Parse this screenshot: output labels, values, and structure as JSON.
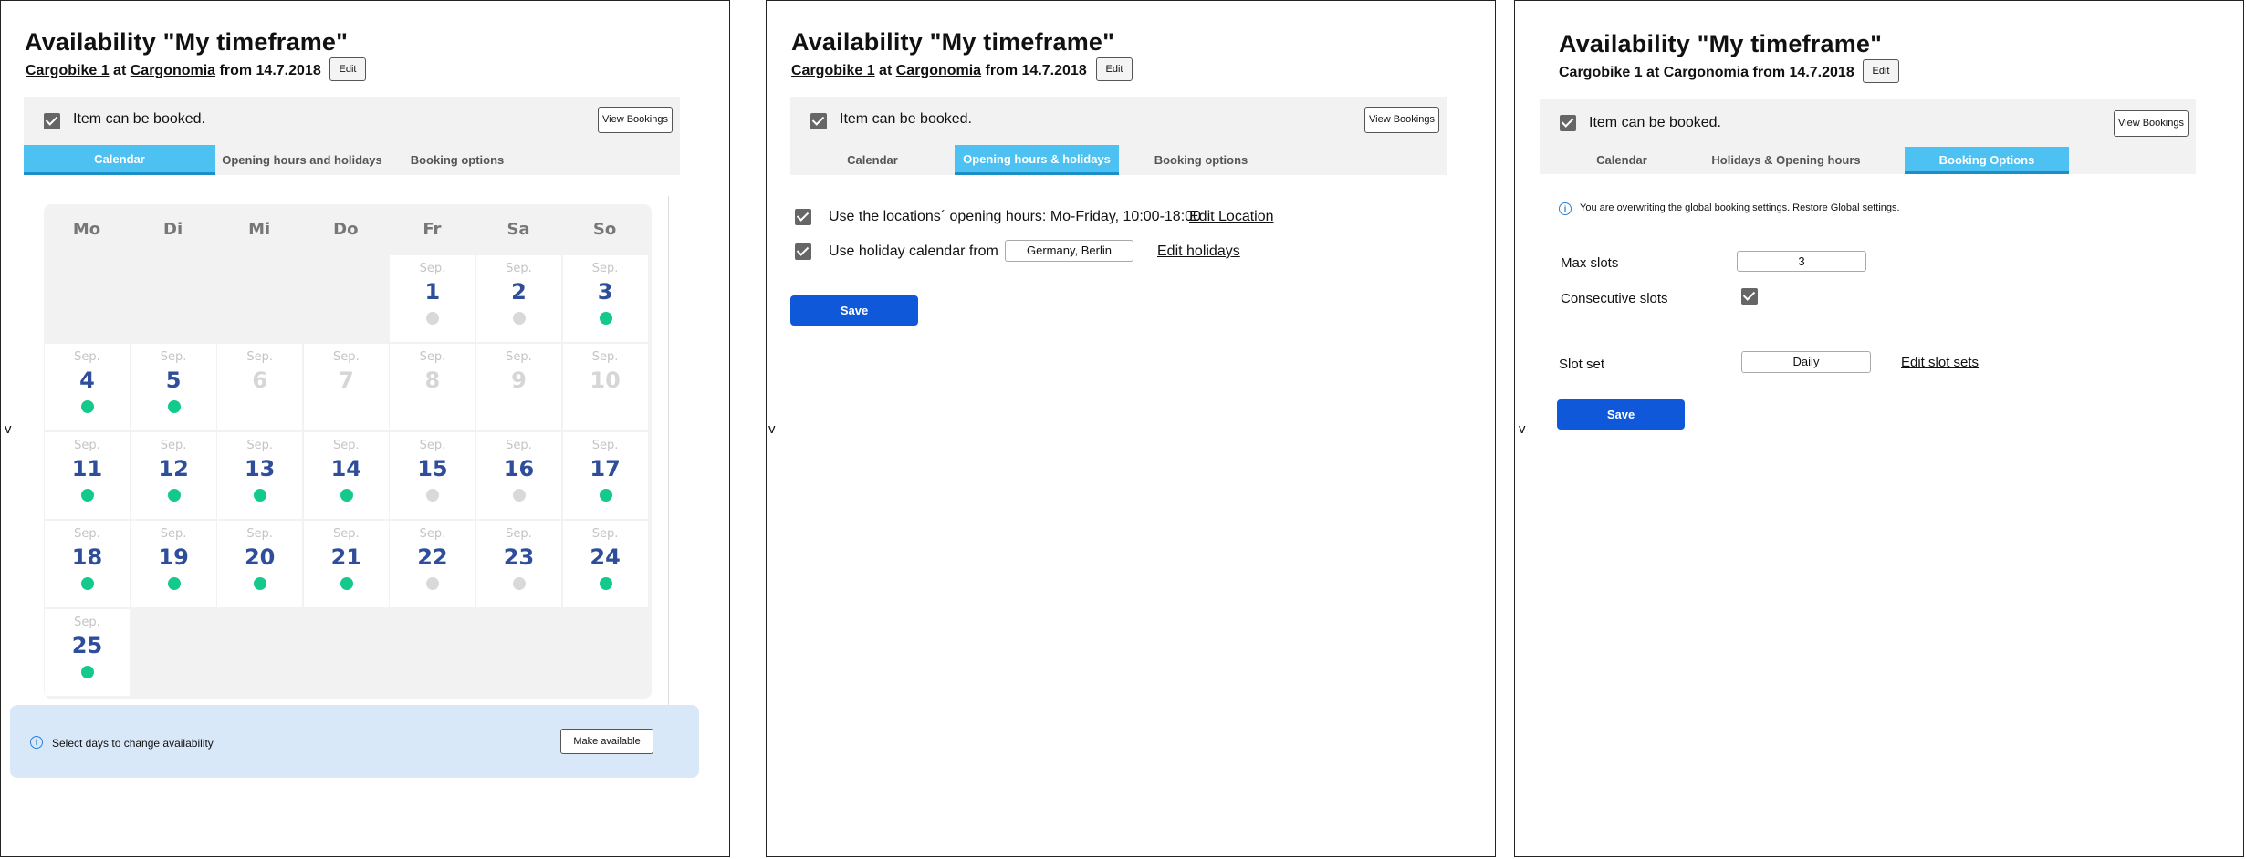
{
  "header": {
    "title": "Availability \"My timeframe\"",
    "item_link": "Cargobike 1",
    "at": "at",
    "location_link": "Cargonomia",
    "from_text": "from 14.7.2018",
    "edit_label": "Edit"
  },
  "bookable": {
    "label": "Item can be booked.",
    "view_bookings_label": "View Bookings"
  },
  "side_label": "v",
  "panel1": {
    "tabs": [
      "Calendar",
      "Opening hours and holidays",
      "Booking options"
    ],
    "active_tab": 0,
    "weekdays": [
      "Mo",
      "Di",
      "Mi",
      "Do",
      "Fr",
      "Sa",
      "So"
    ],
    "month_abbrev": "Sep.",
    "days": [
      {
        "day": "1",
        "status": "unavailable"
      },
      {
        "day": "2",
        "status": "unavailable"
      },
      {
        "day": "3",
        "status": "available"
      },
      {
        "day": "4",
        "status": "available"
      },
      {
        "day": "5",
        "status": "available"
      },
      {
        "day": "6",
        "status": "disabled"
      },
      {
        "day": "7",
        "status": "disabled"
      },
      {
        "day": "8",
        "status": "disabled"
      },
      {
        "day": "9",
        "status": "disabled"
      },
      {
        "day": "10",
        "status": "disabled"
      },
      {
        "day": "11",
        "status": "available"
      },
      {
        "day": "12",
        "status": "available"
      },
      {
        "day": "13",
        "status": "available"
      },
      {
        "day": "14",
        "status": "available"
      },
      {
        "day": "15",
        "status": "unavailable"
      },
      {
        "day": "16",
        "status": "unavailable"
      },
      {
        "day": "17",
        "status": "available"
      },
      {
        "day": "18",
        "status": "available"
      },
      {
        "day": "19",
        "status": "available"
      },
      {
        "day": "20",
        "status": "available"
      },
      {
        "day": "21",
        "status": "available"
      },
      {
        "day": "22",
        "status": "unavailable"
      },
      {
        "day": "23",
        "status": "unavailable"
      },
      {
        "day": "24",
        "status": "available"
      },
      {
        "day": "25",
        "status": "available"
      }
    ],
    "first_weekday_index": 4,
    "info_text": "Select days to change availability",
    "make_available_label": "Make available",
    "colors": {
      "available": "#13c98c",
      "unavailable": "#d9d9d9",
      "tab_active": "#4dc1f2",
      "info_bg": "#d9e8f8"
    }
  },
  "panel2": {
    "tabs": [
      "Calendar",
      "Opening hours & holidays",
      "Booking options"
    ],
    "active_tab": 1,
    "opening_hours_text": "Use the locations´ opening hours: Mo-Friday, 10:00-18:00",
    "edit_location_label": "Edit Location",
    "holiday_text": "Use holiday calendar from",
    "holiday_value": "Germany, Berlin",
    "edit_holidays_label": "Edit holidays",
    "save_label": "Save"
  },
  "panel3": {
    "tabs": [
      "Calendar",
      "Holidays & Opening hours",
      "Booking Options"
    ],
    "active_tab": 2,
    "info_text": "You are overwriting the global booking settings. Restore Global settings.",
    "max_slots_label": "Max slots",
    "max_slots_value": "3",
    "consecutive_label": "Consecutive slots",
    "slot_set_label": "Slot set",
    "slot_set_value": "Daily",
    "edit_slot_sets_label": "Edit slot sets",
    "save_label": "Save"
  }
}
